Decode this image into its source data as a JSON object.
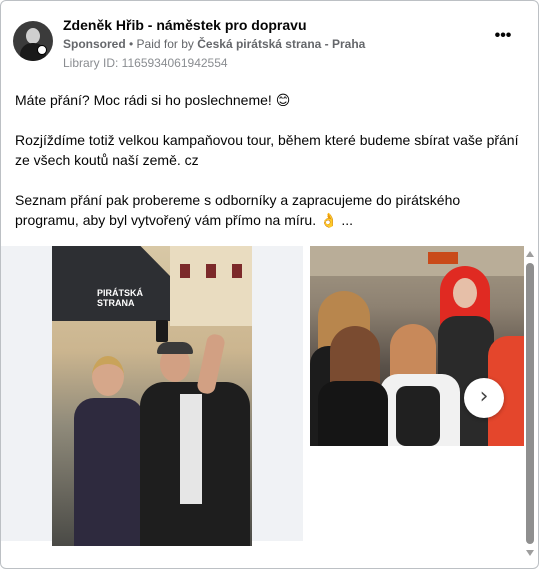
{
  "post": {
    "page_name": "Zdeněk Hřib - náměstek pro dopravu",
    "sponsored_label": "Sponsored",
    "paid_for_prefix": " • Paid for by ",
    "payer": "Česká pirátská strana - Praha",
    "library_id": "Library ID: 1165934061942554",
    "more_label": "•••",
    "paragraphs": [
      "Máte přání? Moc rádi si ho poslechneme! 😊",
      "Rozjíždíme totiž velkou kampaňovou tour, během které budeme sbírat vaše přání ze všech koutů naší země. cz",
      "Seznam přání pak probereme s odborníky a zapracujeme do pirátského programu, aby byl vytvořený vám přímo na míru. 👌 ..."
    ]
  },
  "carousel": {
    "slide1_tent_text": "PIRÁTSKÁ\nSTRANA",
    "next_label": "›"
  },
  "icons": {
    "avatar": "profile-avatar",
    "more": "more-horizontal-icon",
    "next": "chevron-right-icon",
    "scroll_up": "scroll-up-arrow-icon",
    "scroll_down": "scroll-down-arrow-icon"
  },
  "colors": {
    "text": "#050505",
    "meta": "#65676b",
    "border": "#bcc0c4",
    "pirate_tent": "#2d2f33"
  }
}
